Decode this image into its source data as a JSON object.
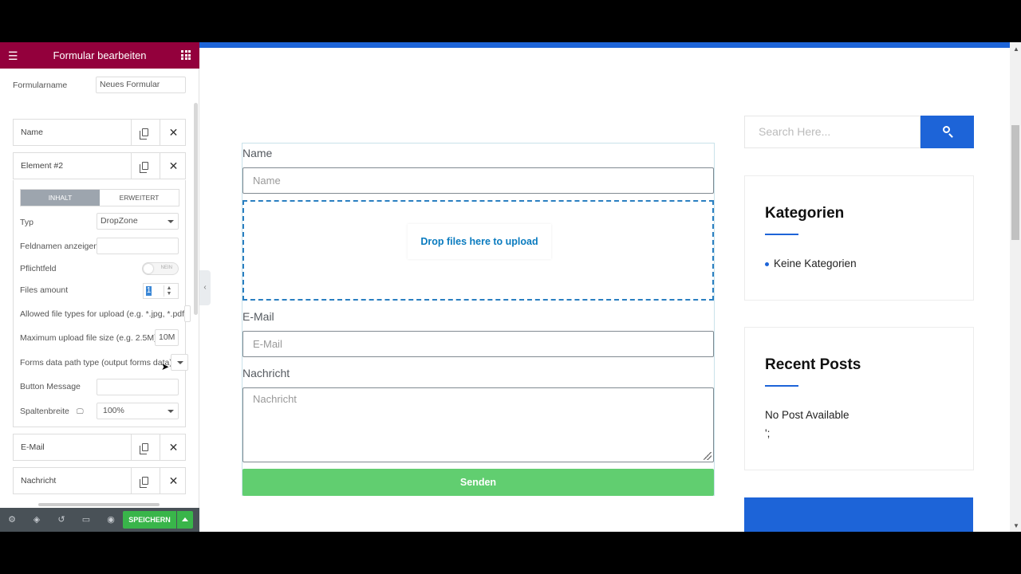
{
  "editor": {
    "header_title": "Formular bearbeiten",
    "form_name_label": "Formularname",
    "form_name_value": "Neues Formular",
    "items": [
      {
        "name": "Name"
      },
      {
        "name": "Element #2"
      },
      {
        "name": "E-Mail"
      },
      {
        "name": "Nachricht"
      }
    ],
    "tabs": {
      "content": "INHALT",
      "advanced": "ERWEITERT"
    },
    "fields": {
      "type_label": "Typ",
      "type_value": "DropZone",
      "show_field_names_label": "Feldnamen anzeigen",
      "required_label": "Pflichtfeld",
      "required_toggle_text": "NEIN",
      "files_amount_label": "Files amount",
      "files_amount_value": "1",
      "allowed_types_label": "Allowed file types for upload (e.g. *.jpg, *.pdf)",
      "max_size_label": "Maximum upload file size (e.g. 2.5M)",
      "max_size_value": "10M",
      "data_path_label": "Forms data path type (output forms data)",
      "button_message_label": "Button Message",
      "column_width_label": "Spaltenbreite",
      "column_width_value": "100%"
    },
    "save_label": "SPEICHERN"
  },
  "form": {
    "name_label": "Name",
    "name_placeholder": "Name",
    "dropzone_message": "Drop files here to upload",
    "email_label": "E-Mail",
    "email_placeholder": "E-Mail",
    "message_label": "Nachricht",
    "message_placeholder": "Nachricht",
    "submit_label": "Senden"
  },
  "sidebar": {
    "search_placeholder": "Search Here...",
    "categories_title": "Kategorien",
    "categories_item": "Keine Kategorien",
    "recent_title": "Recent Posts",
    "recent_text": "No Post Available",
    "recent_extra": "';"
  },
  "colors": {
    "panel_header": "#93003c",
    "accent_blue": "#1d64d8",
    "submit_green": "#61ce70",
    "save_green": "#39b54a"
  }
}
